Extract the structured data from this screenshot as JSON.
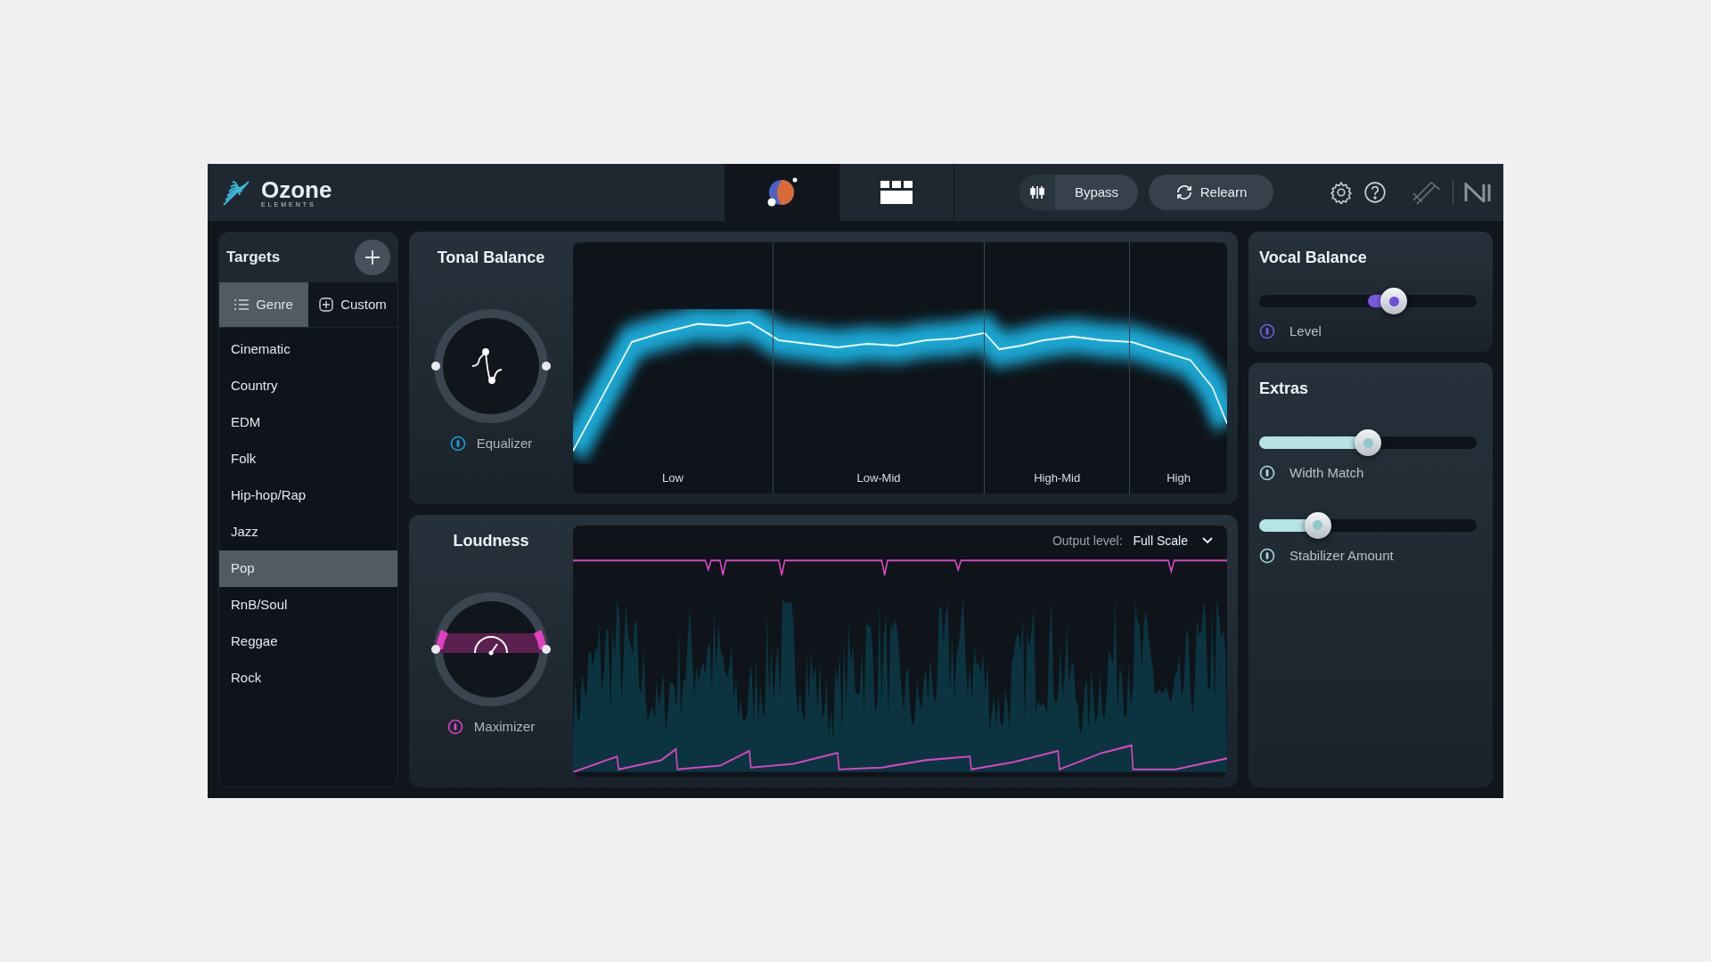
{
  "header": {
    "logo": {
      "name": "Ozone",
      "subtitle": "ELEMENTS"
    },
    "modes": [
      {
        "selected": true
      },
      {
        "selected": false
      }
    ],
    "bypass": {
      "label": "Bypass"
    },
    "relearn": {
      "label": "Relearn"
    }
  },
  "targets": {
    "title": "Targets",
    "tabs": [
      {
        "label": "Genre",
        "selected": true
      },
      {
        "label": "Custom",
        "selected": false
      }
    ],
    "genres": [
      {
        "label": "Cinematic",
        "selected": false
      },
      {
        "label": "Country",
        "selected": false
      },
      {
        "label": "EDM",
        "selected": false
      },
      {
        "label": "Folk",
        "selected": false
      },
      {
        "label": "Hip-hop/Rap",
        "selected": false
      },
      {
        "label": "Jazz",
        "selected": false
      },
      {
        "label": "Pop",
        "selected": true
      },
      {
        "label": "RnB/Soul",
        "selected": false
      },
      {
        "label": "Reggae",
        "selected": false
      },
      {
        "label": "Rock",
        "selected": false
      }
    ]
  },
  "tonal_balance": {
    "title": "Tonal Balance",
    "module": "Equalizer",
    "bands": [
      "Low",
      "Low-Mid",
      "High-Mid",
      "High"
    ]
  },
  "loudness": {
    "title": "Loudness",
    "module": "Maximizer",
    "output_level_label": "Output level:",
    "output_level_value": "Full Scale"
  },
  "vocal_balance": {
    "title": "Vocal Balance",
    "sliders": [
      {
        "label": "Level",
        "level": 0.62,
        "bipolar": true
      }
    ]
  },
  "extras": {
    "title": "Extras",
    "sliders": [
      {
        "label": "Width Match",
        "level": 0.5,
        "bipolar": false
      },
      {
        "label": "Stabilizer Amount",
        "level": 0.27,
        "bipolar": false
      }
    ]
  }
}
